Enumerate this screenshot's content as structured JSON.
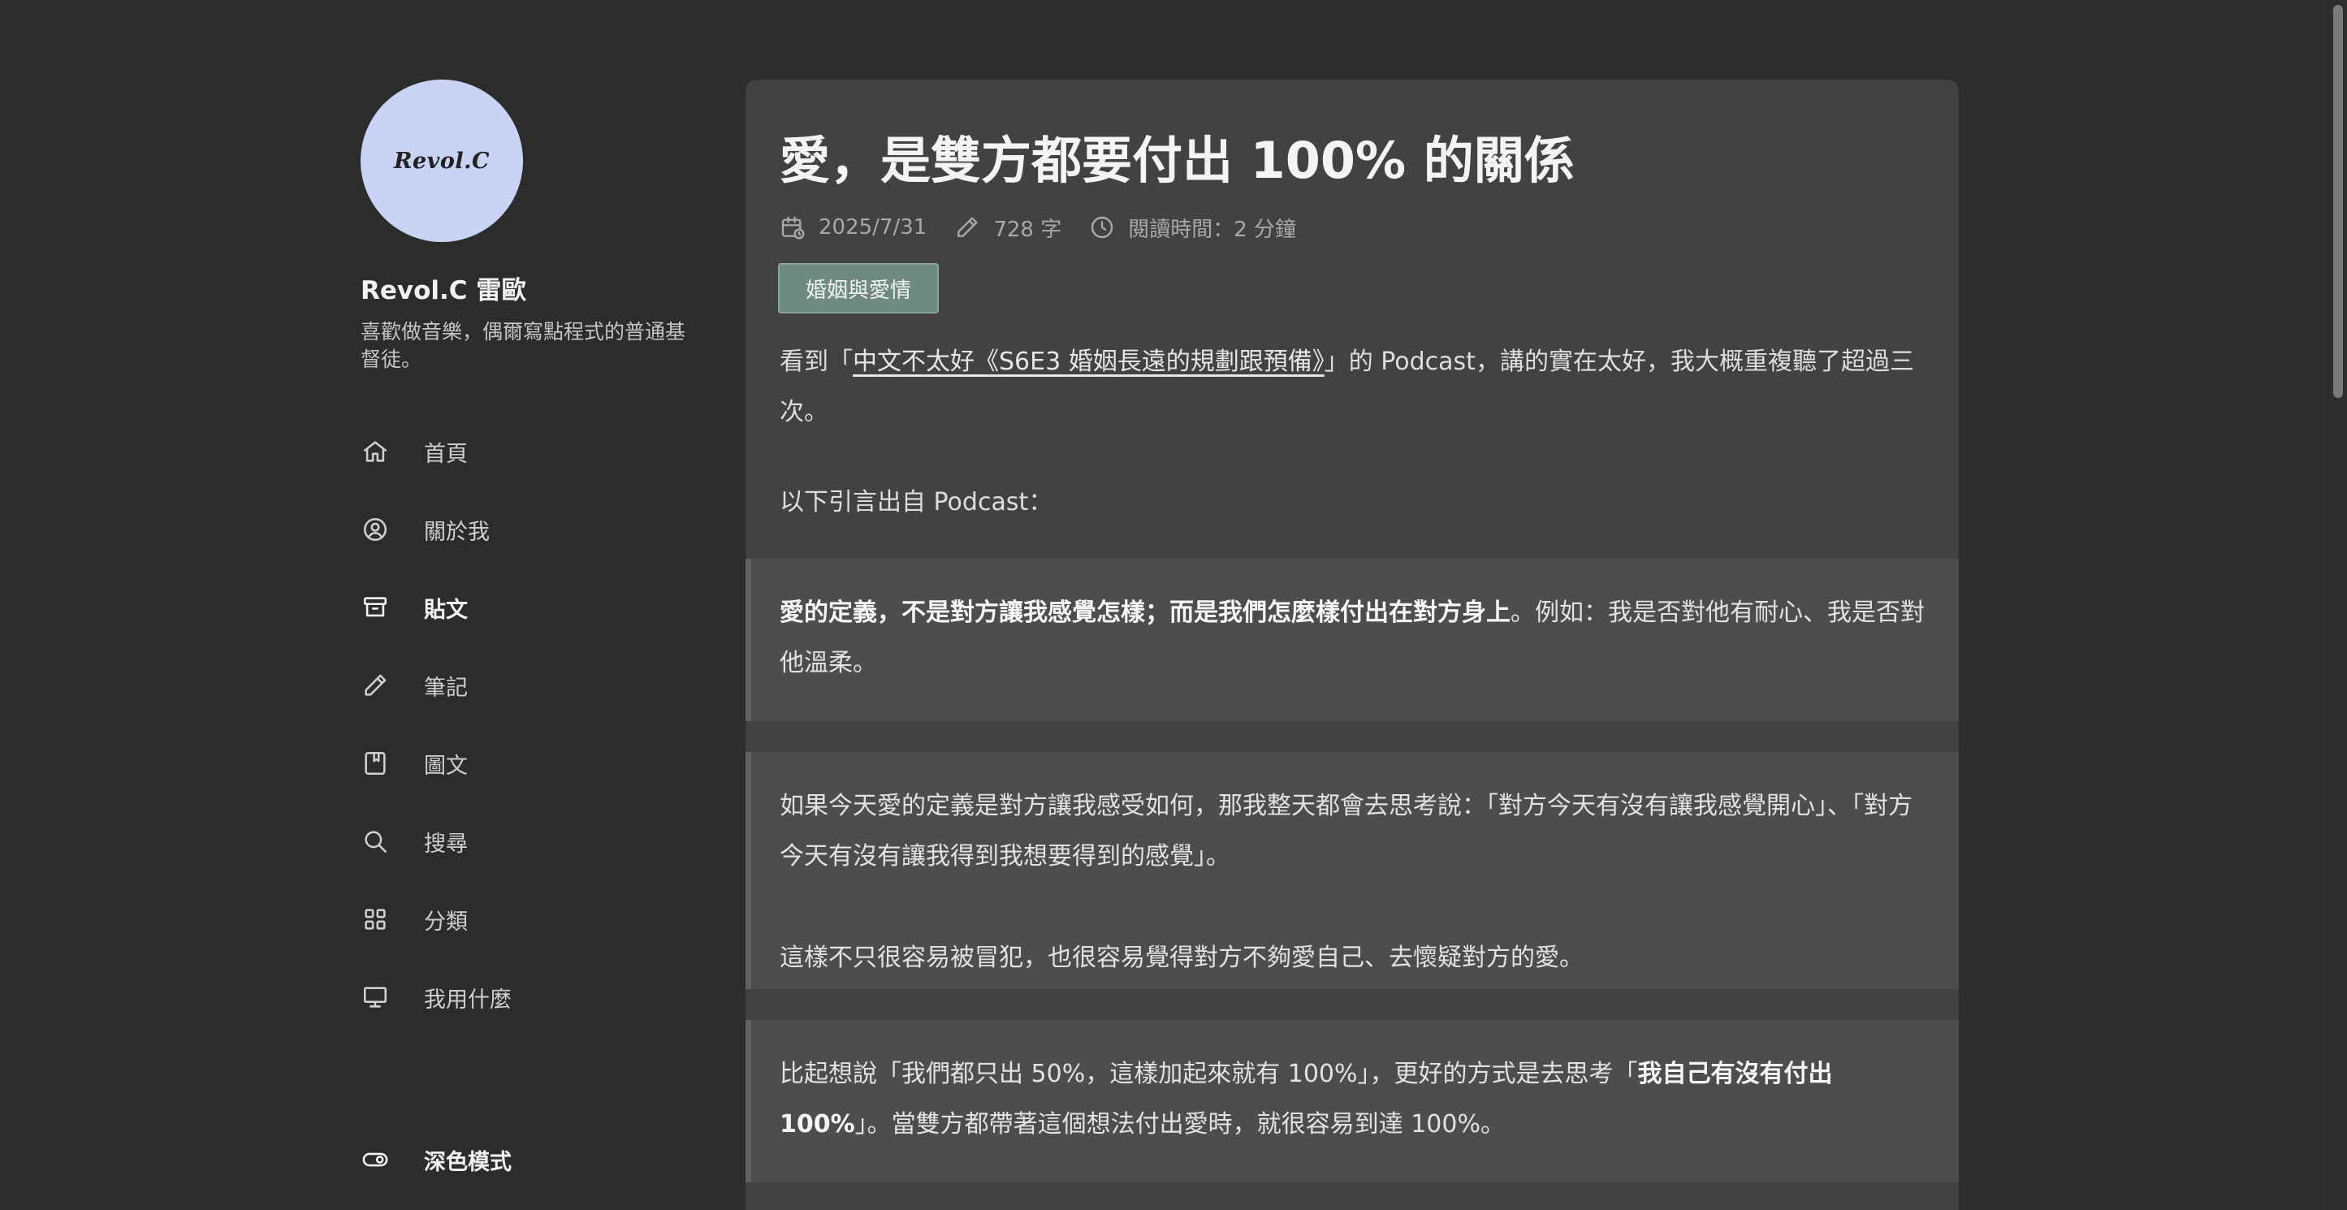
{
  "profile": {
    "avatar_text": "Revol.C",
    "name": "Revol.C 雷歐",
    "description": "喜歡做音樂，偶爾寫點程式的普通基督徒。"
  },
  "nav": {
    "items": [
      {
        "label": "首頁",
        "icon": "home-icon"
      },
      {
        "label": "關於我",
        "icon": "user-circle-icon"
      },
      {
        "label": "貼文",
        "icon": "archive-icon",
        "active": true
      },
      {
        "label": "筆記",
        "icon": "pencil-icon"
      },
      {
        "label": "圖文",
        "icon": "bookmark-book-icon"
      },
      {
        "label": "搜尋",
        "icon": "search-icon"
      },
      {
        "label": "分類",
        "icon": "grid-icon"
      },
      {
        "label": "我用什麼",
        "icon": "monitor-icon"
      }
    ],
    "dark_mode_label": "深色模式"
  },
  "article": {
    "title": "愛，是雙方都要付出 100% 的關係",
    "date": "2025/7/31",
    "word_count": "728 字",
    "reading_time": "閱讀時間：2 分鐘",
    "tag": "婚姻與愛情",
    "intro_prefix": "看到「",
    "intro_link": "中文不太好《S6E3 婚姻長遠的規劃跟預備》",
    "intro_suffix": "」的 Podcast，講的實在太好，我大概重複聽了超過三次。",
    "quote_intro": "以下引言出自 Podcast：",
    "quote1_bold": "愛的定義，不是對方讓我感覺怎樣；而是我們怎麼樣付出在對方身上",
    "quote1_rest": "。例如：我是否對他有耐心、我是否對他溫柔。",
    "quote2_p1": "如果今天愛的定義是對方讓我感受如何，那我整天都會去思考說：「對方今天有沒有讓我感覺開心」、「對方今天有沒有讓我得到我想要得到的感覺」。",
    "quote2_p2": "這樣不只很容易被冒犯，也很容易覺得對方不夠愛自己、去懷疑對方的愛。",
    "quote3_pre": "比起想說「我們都只出 50%，這樣加起來就有 100%」，更好的方式是去思考「",
    "quote3_bold": "我自己有沒有付出 100%",
    "quote3_post": "」。當雙方都帶著這個想法付出愛時，就很容易到達 100%。"
  },
  "colors": {
    "background": "#2c2c2c",
    "card": "#424242",
    "quote": "#4d4d4d",
    "avatar": "#c8d3f5",
    "tag": "#6f8a80"
  }
}
